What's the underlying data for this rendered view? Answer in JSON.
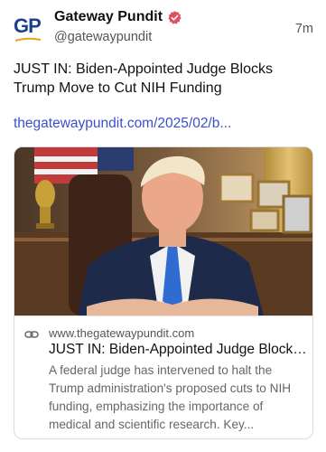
{
  "post": {
    "author": {
      "avatar_text": "GP",
      "display_name": "Gateway Pundit",
      "handle": "@gatewaypundit",
      "verified": true
    },
    "timestamp": "7m",
    "text": "JUST IN: Biden-Appointed Judge Blocks Trump Move to Cut NIH Funding",
    "link_text": "thegatewaypundit.com/2025/02/b..."
  },
  "card": {
    "image_icon": "photo-oval-office-man-at-desk",
    "domain": "www.thegatewaypundit.com",
    "title": "JUST IN: Biden-Appointed Judge Blocks Trump Move to Cut NIH Funding",
    "description": "A federal judge has intervened to halt the Trump administration's proposed cuts to NIH funding, emphasizing the importance of medical and scientific research. Key developments",
    "link_icon": "link-chain-icon"
  },
  "colors": {
    "brand_blue": "#1d3f8f",
    "verified_badge": "#e0505e",
    "link": "#3a4fd0",
    "secondary_text": "#555555"
  }
}
